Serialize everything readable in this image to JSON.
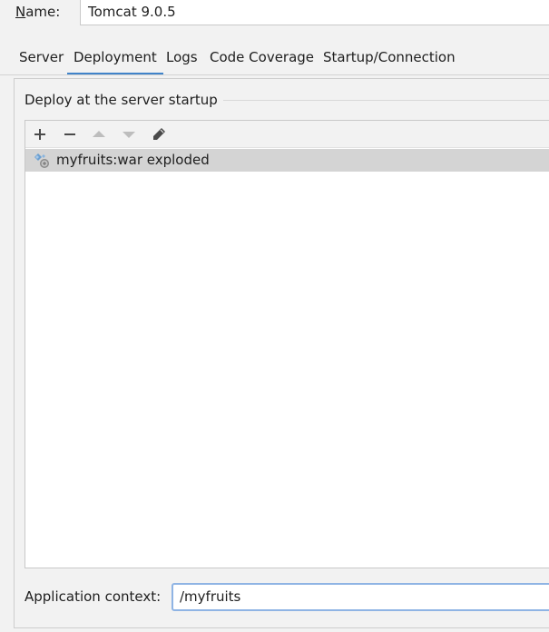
{
  "form": {
    "name_label_mnemonic": "N",
    "name_label_rest": "ame:",
    "name_value": "Tomcat 9.0.5"
  },
  "tabs": [
    {
      "label": "Server"
    },
    {
      "label": "Deployment",
      "selected": true
    },
    {
      "label": "Logs"
    },
    {
      "label": "Code Coverage"
    },
    {
      "label": "Startup/Connection"
    }
  ],
  "deploy": {
    "group_title": "Deploy at the server startup",
    "toolbar": [
      {
        "icon": "plus-icon",
        "enabled": true
      },
      {
        "icon": "minus-icon",
        "enabled": true
      },
      {
        "icon": "move-up-icon",
        "enabled": false
      },
      {
        "icon": "move-down-icon",
        "enabled": false
      },
      {
        "icon": "pencil-icon",
        "enabled": true
      }
    ],
    "artifacts": [
      {
        "label": "myfruits:war exploded",
        "icon": "artifact-exploded-icon",
        "selected": true
      }
    ]
  },
  "app_context": {
    "label": "Application context:",
    "value": "/myfruits"
  },
  "colors": {
    "accent": "#4083c9",
    "selection": "#d4d4d4",
    "field_focus": "#8fb4e4"
  }
}
